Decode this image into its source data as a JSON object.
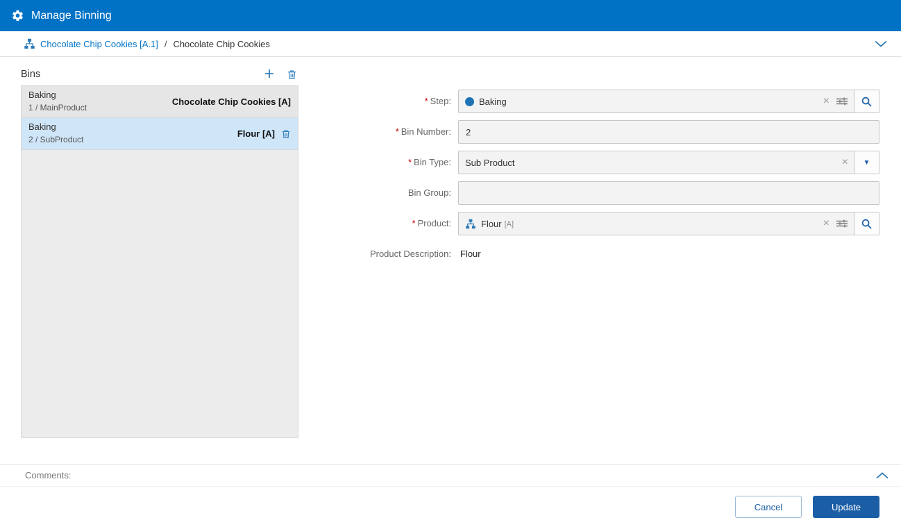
{
  "header": {
    "title": "Manage Binning"
  },
  "breadcrumb": {
    "link": "Chocolate Chip Cookies [A.1]",
    "separator": "/",
    "current": "Chocolate Chip Cookies"
  },
  "bins": {
    "title": "Bins",
    "items": [
      {
        "step": "Baking",
        "detail": "1 / MainProduct",
        "product": "Chocolate Chip Cookies [A]"
      },
      {
        "step": "Baking",
        "detail": "2 / SubProduct",
        "product": "Flour [A]"
      }
    ]
  },
  "form": {
    "required_marker": "*",
    "step": {
      "label": "Step:",
      "value": "Baking"
    },
    "bin_number": {
      "label": "Bin Number:",
      "value": "2"
    },
    "bin_type": {
      "label": "Bin Type:",
      "value": "Sub Product"
    },
    "bin_group": {
      "label": "Bin Group:",
      "value": ""
    },
    "product": {
      "label": "Product:",
      "value": "Flour",
      "suffix": "[A]"
    },
    "product_description": {
      "label": "Product Description:",
      "value": "Flour"
    }
  },
  "comments": {
    "label": "Comments:"
  },
  "footer": {
    "cancel": "Cancel",
    "update": "Update"
  },
  "icons": {
    "plus": "+",
    "clear": "×",
    "caret_down": "▼"
  },
  "colors": {
    "header_bg": "#0072C6",
    "accent": "#2B7BB9",
    "link": "#0072C6",
    "primary_button": "#1B5EA6",
    "selected_row": "#CFE5F8",
    "required": "#C00000"
  }
}
